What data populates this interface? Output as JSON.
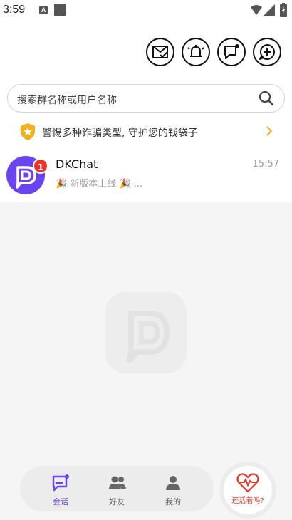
{
  "status_bar": {
    "time": "3:59",
    "a_label": "A"
  },
  "top_actions": [
    {
      "icon": "mail-check-icon"
    },
    {
      "icon": "alarm-bell-icon"
    },
    {
      "icon": "chat-bubble-icon"
    },
    {
      "icon": "add-chat-icon"
    }
  ],
  "search": {
    "placeholder": "搜索群名称或用户名称",
    "icon": "search-icon"
  },
  "notice": {
    "text": "警惕多种诈骗类型, 守护您的钱袋子",
    "icon": "shield-star-icon"
  },
  "chat_list": [
    {
      "name": "DKChat",
      "message": "🎉 新版本上线 🎉 ...",
      "time": "15:57",
      "unread": "1",
      "avatar": "dkchat-logo"
    }
  ],
  "tabs": [
    {
      "label": "会话",
      "icon": "conversation-icon",
      "active": true
    },
    {
      "label": "好友",
      "icon": "friends-icon",
      "active": false
    },
    {
      "label": "我的",
      "icon": "profile-icon",
      "active": false
    }
  ],
  "float_button": {
    "label": "还活着吗?",
    "icon": "heartbeat-icon"
  },
  "colors": {
    "accent": "#6a44f0",
    "alert": "#e8322b",
    "notice_icon": "#f2b01e"
  }
}
